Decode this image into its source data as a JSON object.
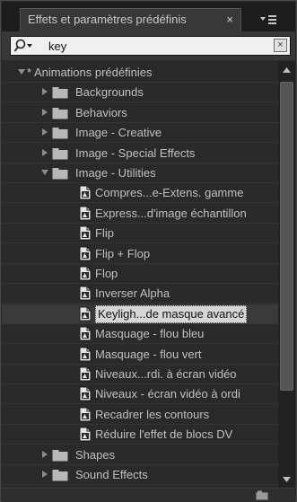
{
  "panel": {
    "tab_title": "Effets et paramètres prédéfinis",
    "tab_close": "×",
    "menu_icon": "panel-menu-icon"
  },
  "search": {
    "value": "key",
    "placeholder": "",
    "clear": "×",
    "icon": "search-icon"
  },
  "tree": {
    "items": [
      {
        "label": "* Animations prédéfinies",
        "level": 0,
        "kind": "category",
        "expanded": true
      },
      {
        "label": "Backgrounds",
        "level": 1,
        "kind": "folder",
        "expanded": false
      },
      {
        "label": "Behaviors",
        "level": 1,
        "kind": "folder",
        "expanded": false
      },
      {
        "label": "Image - Creative",
        "level": 1,
        "kind": "folder",
        "expanded": false
      },
      {
        "label": "Image - Special Effects",
        "level": 1,
        "kind": "folder",
        "expanded": false
      },
      {
        "label": "Image - Utilities",
        "level": 1,
        "kind": "folder",
        "expanded": true
      },
      {
        "label": "Compres...e-Extens. gamme",
        "level": 2,
        "kind": "preset"
      },
      {
        "label": "Express...d'image échantillon",
        "level": 2,
        "kind": "preset"
      },
      {
        "label": "Flip",
        "level": 2,
        "kind": "preset"
      },
      {
        "label": "Flip + Flop",
        "level": 2,
        "kind": "preset"
      },
      {
        "label": "Flop",
        "level": 2,
        "kind": "preset"
      },
      {
        "label": "Inverser Alpha",
        "level": 2,
        "kind": "preset"
      },
      {
        "label": "Keyligh...de masque avancé",
        "level": 2,
        "kind": "preset",
        "selected": true
      },
      {
        "label": "Masquage - flou bleu",
        "level": 2,
        "kind": "preset"
      },
      {
        "label": "Masquage - flou vert",
        "level": 2,
        "kind": "preset"
      },
      {
        "label": "Niveaux...rdi. à écran vidéo",
        "level": 2,
        "kind": "preset"
      },
      {
        "label": "Niveaux - écran vidéo à ordi",
        "level": 2,
        "kind": "preset"
      },
      {
        "label": "Recadrer les contours",
        "level": 2,
        "kind": "preset"
      },
      {
        "label": "Réduire l'effet de blocs DV",
        "level": 2,
        "kind": "preset"
      },
      {
        "label": "Shapes",
        "level": 1,
        "kind": "folder",
        "expanded": false
      },
      {
        "label": "Sound Effects",
        "level": 1,
        "kind": "folder",
        "expanded": false
      }
    ]
  },
  "colors": {
    "panel_bg": "#2a2a2a",
    "text": "#c0c0c0",
    "selected_bg": "#d6d6d6"
  }
}
